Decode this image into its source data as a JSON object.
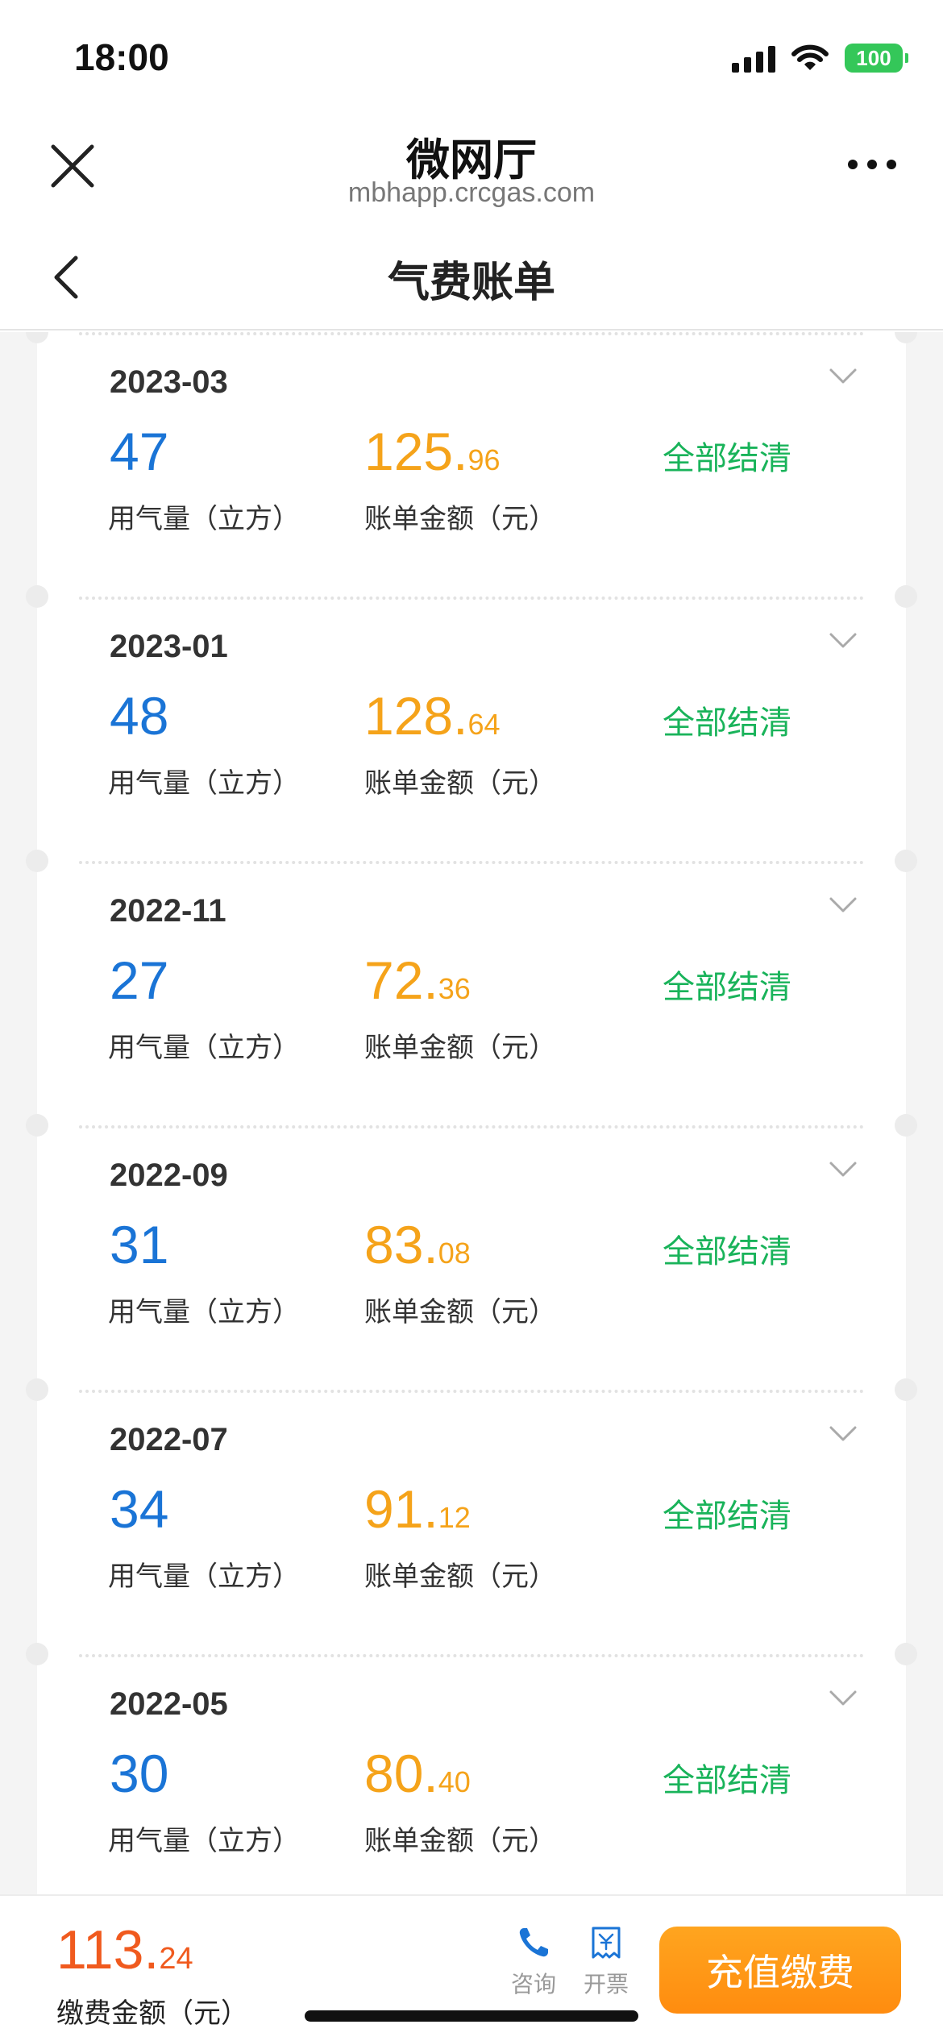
{
  "status_bar": {
    "time": "18:00",
    "battery": "100"
  },
  "title_bar": {
    "title": "微网厅",
    "subtitle": "mbhapp.crcgas.com"
  },
  "nav": {
    "title": "气费账单"
  },
  "labels": {
    "usage": "用气量（立方）",
    "amount": "账单金额（元）"
  },
  "bills": [
    {
      "date": "2023-03",
      "usage": "47",
      "amount_int": "125",
      "amount_dec": "96",
      "status": "全部结清"
    },
    {
      "date": "2023-01",
      "usage": "48",
      "amount_int": "128",
      "amount_dec": "64",
      "status": "全部结清"
    },
    {
      "date": "2022-11",
      "usage": "27",
      "amount_int": "72",
      "amount_dec": "36",
      "status": "全部结清"
    },
    {
      "date": "2022-09",
      "usage": "31",
      "amount_int": "83",
      "amount_dec": "08",
      "status": "全部结清"
    },
    {
      "date": "2022-07",
      "usage": "34",
      "amount_int": "91",
      "amount_dec": "12",
      "status": "全部结清"
    },
    {
      "date": "2022-05",
      "usage": "30",
      "amount_int": "80",
      "amount_dec": "40",
      "status": "全部结清"
    }
  ],
  "bottom": {
    "amount_int": "113",
    "amount_dec": "24",
    "amount_label": "缴费金额（元）",
    "consult_label": "咨询",
    "invoice_label": "开票",
    "pay_button": "充值缴费"
  },
  "colors": {
    "usage": "#1a74d6",
    "amount": "#f5a31a",
    "settled": "#19b35a",
    "pay_amount": "#f05a1e",
    "pay_button": "#ff9a16"
  }
}
